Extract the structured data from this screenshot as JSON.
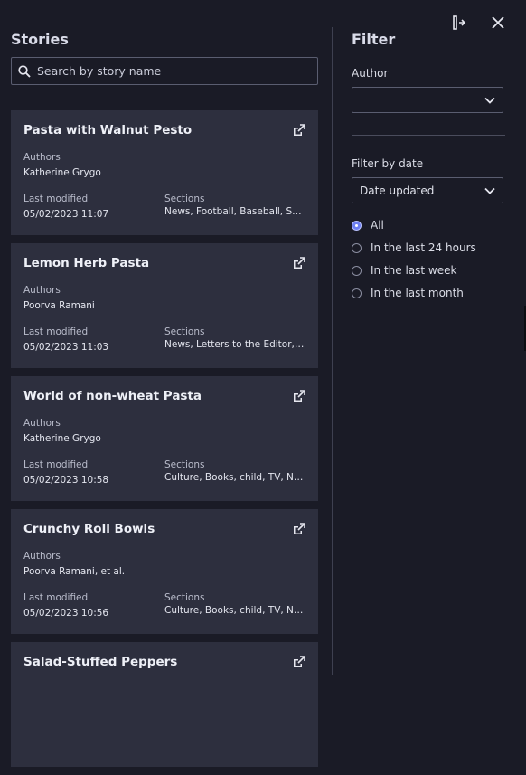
{
  "stories": {
    "title": "Stories",
    "search_placeholder": "Search by story name",
    "cards": [
      {
        "title": "Pasta with Walnut Pesto",
        "authors_label": "Authors",
        "authors": "Katherine Grygo",
        "modified_label": "Last modified",
        "modified": "05/02/2023 11:07",
        "sections_label": "Sections",
        "sections": "News, Football, Baseball, Sp..."
      },
      {
        "title": "Lemon Herb Pasta",
        "authors_label": "Authors",
        "authors": "Poorva Ramani",
        "modified_label": "Last modified",
        "modified": "05/02/2023 11:03",
        "sections_label": "Sections",
        "sections": "News, Letters to the Editor, ..."
      },
      {
        "title": "World of non-wheat Pasta",
        "authors_label": "Authors",
        "authors": "Katherine Grygo",
        "modified_label": "Last modified",
        "modified": "05/02/2023 10:58",
        "sections_label": "Sections",
        "sections": "Culture, Books, child, TV, Ne..."
      },
      {
        "title": "Crunchy Roll Bowls",
        "authors_label": "Authors",
        "authors": "Poorva Ramani, et al.",
        "modified_label": "Last modified",
        "modified": "05/02/2023 10:56",
        "sections_label": "Sections",
        "sections": "Culture, Books, child, TV, Ne..."
      },
      {
        "title": "Salad-Stuffed Peppers",
        "authors_label": "",
        "authors": "",
        "modified_label": "",
        "modified": "",
        "sections_label": "",
        "sections": ""
      }
    ]
  },
  "filter": {
    "title": "Filter",
    "author_label": "Author",
    "author_value": "",
    "date_label": "Filter by date",
    "date_value": "Date updated",
    "options": [
      "All",
      "In the last 24 hours",
      "In the last week",
      "In the last month"
    ],
    "selected": "All"
  },
  "icons": {
    "collapse": "collapse-panel-icon",
    "close": "close-icon",
    "search": "search-icon",
    "open": "open-external-icon",
    "chevron": "chevron-down-icon"
  },
  "colors": {
    "background": "#1a1b26",
    "card": "#2d2f3e",
    "accent": "#6d7ff0"
  }
}
